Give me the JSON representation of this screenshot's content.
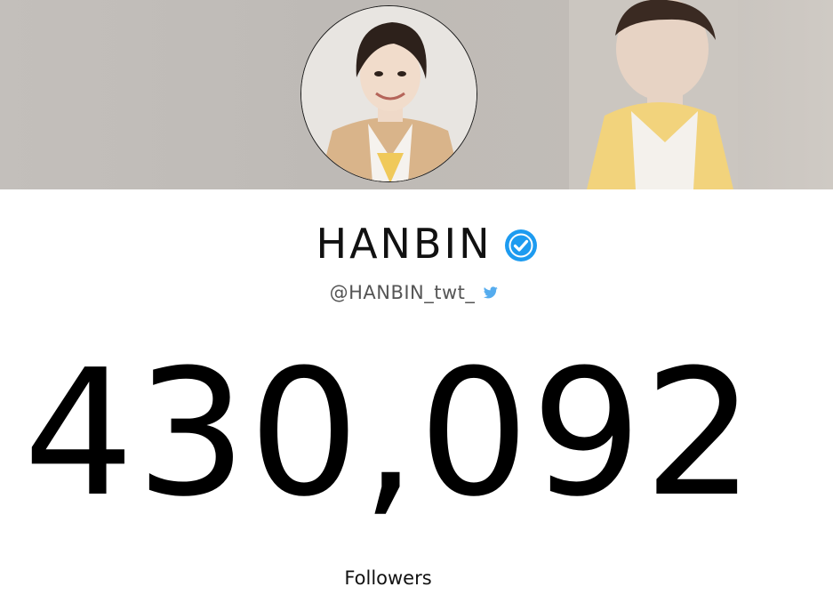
{
  "profile": {
    "name": "HANBIN",
    "handle": "@HANBIN_twt_",
    "verified_icon": "verified-badge-icon",
    "platform_icon": "twitter-bird-icon"
  },
  "stats": {
    "followers_count": "430,092",
    "followers_label": "Followers"
  },
  "colors": {
    "verified_blue": "#1d9bf0",
    "twitter_blue": "#55acee",
    "banner_gray": "#c1bdb9"
  }
}
